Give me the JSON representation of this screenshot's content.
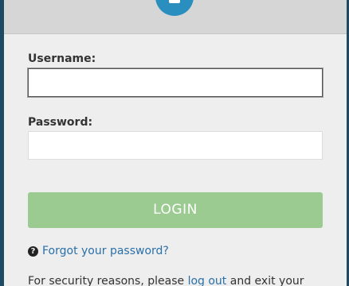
{
  "form": {
    "username_label": "Username:",
    "username_value": "",
    "password_label": "Password:",
    "password_value": "",
    "login_label": "LOGIN",
    "forgot_label": "Forgot your password?"
  },
  "notice": {
    "prefix": "For security reasons, please ",
    "link": "log out",
    "suffix": " and exit your"
  },
  "colors": {
    "background": "#1e4a63",
    "accent": "#2a8fbf",
    "login_button": "#9ccb91",
    "link": "#2a6fa8"
  },
  "icons": [
    "lock-logo-icon",
    "question-circle-icon"
  ]
}
